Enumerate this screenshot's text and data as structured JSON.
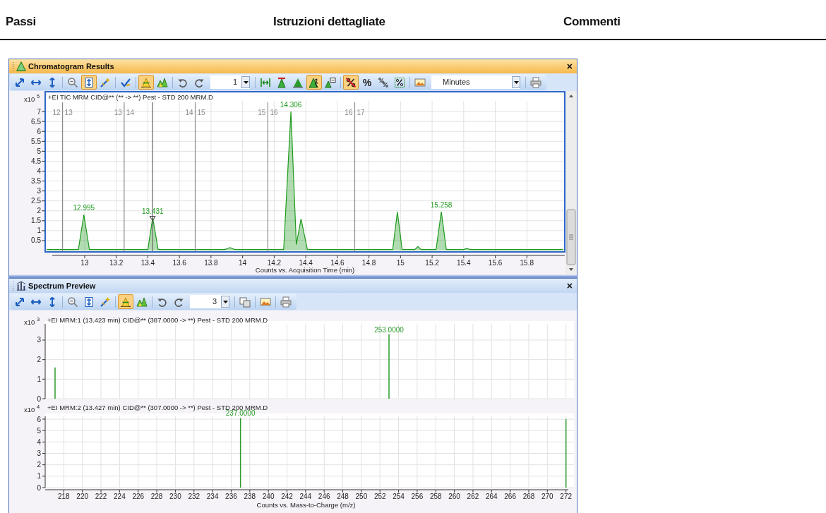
{
  "page_header": {
    "columns": [
      "Passi",
      "Istruzioni dettagliate",
      "Commenti"
    ]
  },
  "chromatogram_pane": {
    "title": "Chromatogram Results",
    "close": "×",
    "toolbar": [
      {
        "kind": "diagonal",
        "selected": false
      },
      {
        "kind": "horizontal",
        "selected": false
      },
      {
        "kind": "vertical",
        "selected": false
      },
      {
        "kind": "separator"
      },
      {
        "kind": "zoomout",
        "selected": false
      },
      {
        "kind": "fitheight",
        "selected": true
      },
      {
        "kind": "wand",
        "selected": false
      },
      {
        "kind": "separator"
      },
      {
        "kind": "check",
        "selected": false
      },
      {
        "kind": "separator"
      },
      {
        "kind": "peakpick",
        "selected": true
      },
      {
        "kind": "peaks",
        "selected": false
      },
      {
        "kind": "separator"
      },
      {
        "kind": "undo",
        "selected": false
      },
      {
        "kind": "redo",
        "selected": false
      },
      {
        "kind": "spin",
        "value": "1"
      },
      {
        "kind": "separator"
      },
      {
        "kind": "hfit",
        "selected": false
      },
      {
        "kind": "redpeak",
        "selected": false
      },
      {
        "kind": "peak",
        "selected": false
      },
      {
        "kind": "manualpeak",
        "selected": true
      },
      {
        "kind": "label",
        "selected": false
      },
      {
        "kind": "separator"
      },
      {
        "kind": "nopercent",
        "selected": true
      },
      {
        "kind": "text",
        "label": "%",
        "selected": false
      },
      {
        "kind": "percentslash",
        "selected": false
      },
      {
        "kind": "percentbox",
        "selected": false
      },
      {
        "kind": "separator"
      },
      {
        "kind": "image",
        "selected": false
      },
      {
        "kind": "dropdown",
        "value": "Minutes"
      },
      {
        "kind": "separator"
      },
      {
        "kind": "print",
        "selected": false
      }
    ],
    "plot": {
      "y_scale_exponent": "5",
      "segment_labels": [
        [
          "12",
          "13"
        ],
        [
          "13",
          "14"
        ],
        [
          "14",
          "15"
        ],
        [
          "15",
          "16"
        ],
        [
          "16",
          "17"
        ]
      ],
      "chart_data": {
        "type": "area",
        "grid": true,
        "title": "+EI TIC MRM CID@** (** -> **) Pest - STD 200 MRM.D",
        "xlabel": "Counts vs. Acquisition Time (min)",
        "ylabel": "x10",
        "x": [
          12.76,
          12.96,
          12.995,
          13.03,
          13.4,
          13.431,
          13.465,
          13.89,
          13.92,
          13.95,
          14.26,
          14.306,
          14.34,
          14.37,
          14.41,
          14.95,
          14.98,
          15.01,
          15.09,
          15.11,
          15.13,
          15.225,
          15.258,
          15.29,
          15.4,
          15.42,
          15.44,
          16.03
        ],
        "series": [
          {
            "color": "#1f9a1f",
            "values": [
              0.05,
              0.05,
              1.8,
              0.05,
              0.05,
              1.65,
              0.05,
              0.05,
              0.15,
              0.05,
              0.05,
              7.0,
              0.3,
              1.6,
              0.05,
              0.05,
              1.95,
              0.05,
              0.05,
              0.2,
              0.05,
              0.05,
              1.95,
              0.05,
              0.05,
              0.1,
              0.05,
              0.05
            ]
          }
        ],
        "xlim": [
          12.75,
          16.04
        ],
        "ylim": [
          0,
          8
        ],
        "xticks": [
          13,
          13.2,
          13.4,
          13.6,
          13.8,
          14,
          14.2,
          14.4,
          14.6,
          14.8,
          15,
          15.2,
          15.4,
          15.6,
          15.8
        ],
        "yticks": [
          0.5,
          1,
          1.5,
          2,
          2.5,
          3,
          3.5,
          4,
          4.5,
          5,
          5.5,
          6,
          6.5,
          7
        ],
        "ref_lines": [
          {
            "axis": "x",
            "value": 12.86,
            "color": "#8a8a8a"
          },
          {
            "axis": "x",
            "value": 13.25,
            "color": "#8a8a8a"
          },
          {
            "axis": "x",
            "value": 13.7,
            "color": "#8a8a8a"
          },
          {
            "axis": "x",
            "value": 14.16,
            "color": "#8a8a8a"
          },
          {
            "axis": "x",
            "value": 14.71,
            "color": "#8a8a8a"
          },
          {
            "axis": "x",
            "value": 13.43,
            "color": "#666666"
          }
        ],
        "annotations": [
          {
            "x": 12.995,
            "y": 1.8,
            "text": "12.995"
          },
          {
            "x": 13.431,
            "y": 1.65,
            "text": "13.431"
          },
          {
            "x": 14.306,
            "y": 7.0,
            "text": "14.306"
          },
          {
            "x": 15.258,
            "y": 1.95,
            "text": "15.258"
          }
        ]
      }
    }
  },
  "spectrum_pane": {
    "title": "Spectrum Preview",
    "close": "×",
    "toolbar": [
      {
        "kind": "diagonal",
        "selected": false
      },
      {
        "kind": "horizontal",
        "selected": false
      },
      {
        "kind": "vertical",
        "selected": false
      },
      {
        "kind": "separator"
      },
      {
        "kind": "zoomout",
        "selected": false
      },
      {
        "kind": "fitheight",
        "selected": false
      },
      {
        "kind": "wand",
        "selected": false
      },
      {
        "kind": "separator"
      },
      {
        "kind": "peakpick",
        "selected": true
      },
      {
        "kind": "peaks",
        "selected": false
      },
      {
        "kind": "separator"
      },
      {
        "kind": "undo",
        "selected": false
      },
      {
        "kind": "redo",
        "selected": false
      },
      {
        "kind": "spin",
        "value": "3"
      },
      {
        "kind": "separator"
      },
      {
        "kind": "copy",
        "selected": false
      },
      {
        "kind": "separator"
      },
      {
        "kind": "image",
        "selected": false
      },
      {
        "kind": "separator"
      },
      {
        "kind": "print",
        "selected": false
      }
    ],
    "plots": [
      {
        "y_scale_exponent": "3",
        "chart_data": {
          "type": "bar",
          "grid": true,
          "title": "+EI MRM:1 (13.423 min) CID@** (387.0000 -> **) Pest - STD 200 MRM.D",
          "ylabel": "x10",
          "x": [
            217.06,
            252.97
          ],
          "series": [
            {
              "color": "#2a9a2a",
              "values": [
                1.6,
                3.3
              ]
            }
          ],
          "xlim": [
            216,
            272.1
          ],
          "ylim": [
            0,
            3.83
          ],
          "yticks": [
            0,
            1,
            2,
            3
          ],
          "annotations": [
            {
              "x": 252.97,
              "y": 3.3,
              "text": "253.0000"
            }
          ]
        }
      },
      {
        "y_scale_exponent": "4",
        "chart_data": {
          "type": "bar",
          "grid": true,
          "title": "+EI MRM:2 (13.427 min) CID@** (307.0000 -> **) Pest - STD 200 MRM.D",
          "xlabel": "Counts vs. Mass-to-Charge (m/z)",
          "ylabel": "x10",
          "x": [
            237,
            272
          ],
          "series": [
            {
              "color": "#2a9a2a",
              "values": [
                6.1,
                6.0
              ]
            }
          ],
          "xlim": [
            216,
            272.1
          ],
          "ylim": [
            0,
            6.25
          ],
          "xticks": [
            218,
            220,
            222,
            224,
            226,
            228,
            230,
            232,
            234,
            236,
            238,
            240,
            242,
            244,
            246,
            248,
            250,
            252,
            254,
            256,
            258,
            260,
            262,
            264,
            266,
            268,
            270,
            272
          ],
          "yticks": [
            0,
            1,
            2,
            3,
            4,
            5,
            6
          ],
          "annotations": [
            {
              "x": 237,
              "y": 6.1,
              "text": "237.0000"
            }
          ]
        }
      }
    ]
  }
}
